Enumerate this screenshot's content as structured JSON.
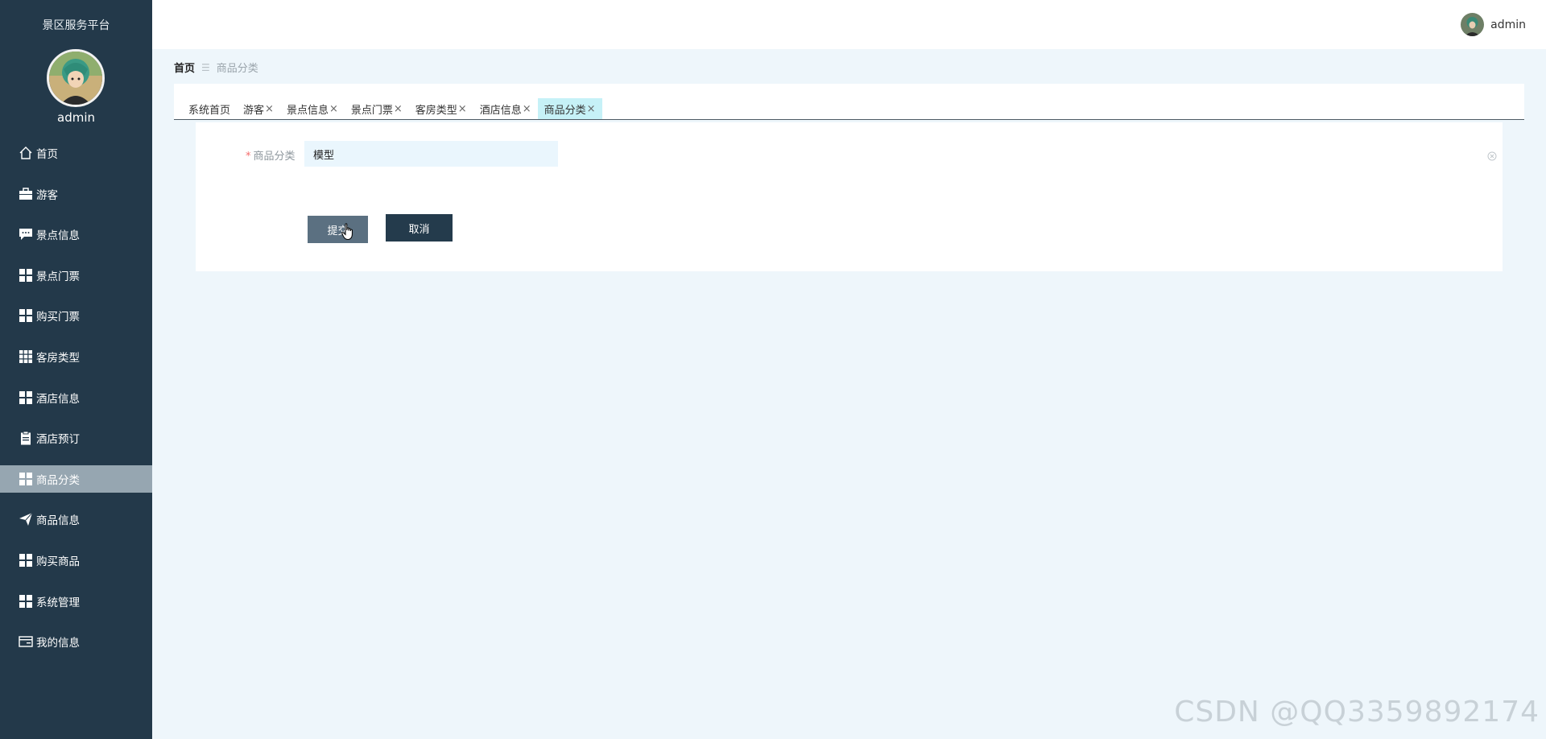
{
  "app": {
    "title": "景区服务平台"
  },
  "sidebar": {
    "username": "admin",
    "items": [
      {
        "label": "首页",
        "icon": "home-icon"
      },
      {
        "label": "游客",
        "icon": "briefcase-icon"
      },
      {
        "label": "景点信息",
        "icon": "comment-icon"
      },
      {
        "label": "景点门票",
        "icon": "grid-icon"
      },
      {
        "label": "购买门票",
        "icon": "grid-icon"
      },
      {
        "label": "客房类型",
        "icon": "grid9-icon"
      },
      {
        "label": "酒店信息",
        "icon": "grid-icon"
      },
      {
        "label": "酒店预订",
        "icon": "clipboard-icon"
      },
      {
        "label": "商品分类",
        "icon": "grid-icon",
        "active": true
      },
      {
        "label": "商品信息",
        "icon": "send-icon"
      },
      {
        "label": "购买商品",
        "icon": "grid-icon"
      },
      {
        "label": "系统管理",
        "icon": "grid-icon"
      },
      {
        "label": "我的信息",
        "icon": "card-icon"
      }
    ]
  },
  "header": {
    "username": "admin"
  },
  "breadcrumb": {
    "home": "首页",
    "separator": "☰",
    "current": "商品分类"
  },
  "tabs": [
    {
      "label": "系统首页",
      "closable": false
    },
    {
      "label": "游客",
      "closable": true
    },
    {
      "label": "景点信息",
      "closable": true
    },
    {
      "label": "景点门票",
      "closable": true
    },
    {
      "label": "客房类型",
      "closable": true
    },
    {
      "label": "酒店信息",
      "closable": true
    },
    {
      "label": "商品分类",
      "closable": true,
      "active": true
    }
  ],
  "form": {
    "required_mark": "*",
    "field_label": "商品分类",
    "field_value": "模型",
    "submit_label": "提交",
    "cancel_label": "取消"
  },
  "watermark": "CSDN @QQ3359892174",
  "colors": {
    "sidebar_bg": "#23394a",
    "sidebar_active": "#96a6b1",
    "page_bg": "#eef6fb",
    "tab_active": "#c6f1f7",
    "submit_bg": "#5b7081",
    "cancel_bg": "#243b4c"
  }
}
